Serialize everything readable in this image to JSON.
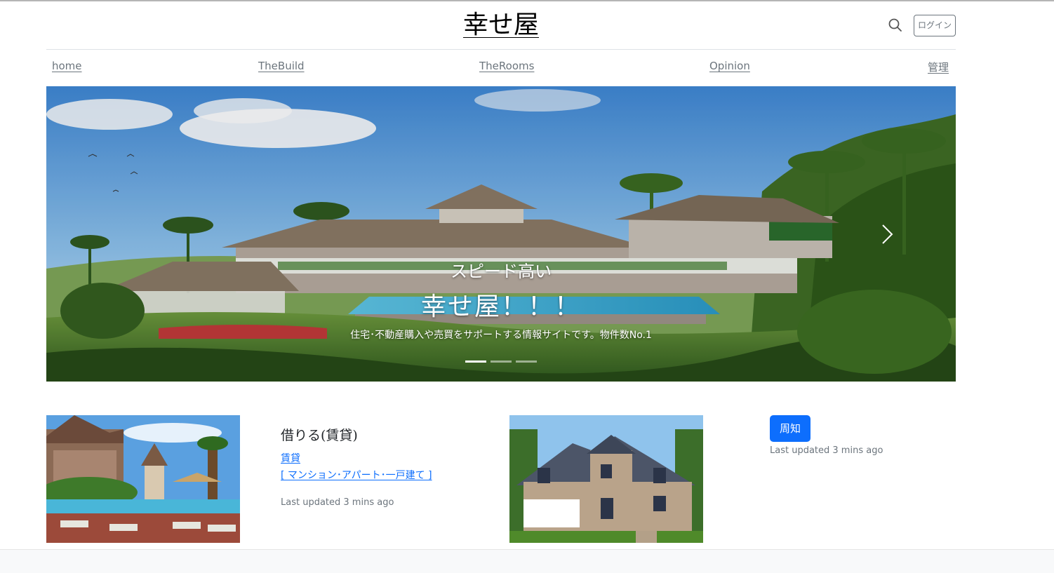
{
  "header": {
    "site_title": "幸せ屋",
    "login_label": "ログイン",
    "search_icon": "search-icon"
  },
  "nav": {
    "items": [
      {
        "label": "home"
      },
      {
        "label": "TheBuild"
      },
      {
        "label": "TheRooms"
      },
      {
        "label": "Opinion"
      },
      {
        "label": "管理"
      }
    ]
  },
  "carousel": {
    "subtitle": "スピード高い",
    "title": "幸せ屋！！！",
    "description": "住宅･不動産購入や売買をサポートする情報サイトです。物件数No.1",
    "next_icon": "chevron-right-icon",
    "slide_count": 3,
    "active_slide": 1
  },
  "cards": {
    "rental": {
      "title": "借りる(賃貸)",
      "link1": "賃貸",
      "link2": "[ マンション･アパート･一戸建て ]",
      "updated": "Last updated 3 mins ago"
    },
    "notice": {
      "button_label": "周知",
      "updated": "Last updated 3 mins ago"
    }
  },
  "colors": {
    "primary": "#0d6efd",
    "muted": "#6c757d",
    "border": "#dee2e6"
  }
}
